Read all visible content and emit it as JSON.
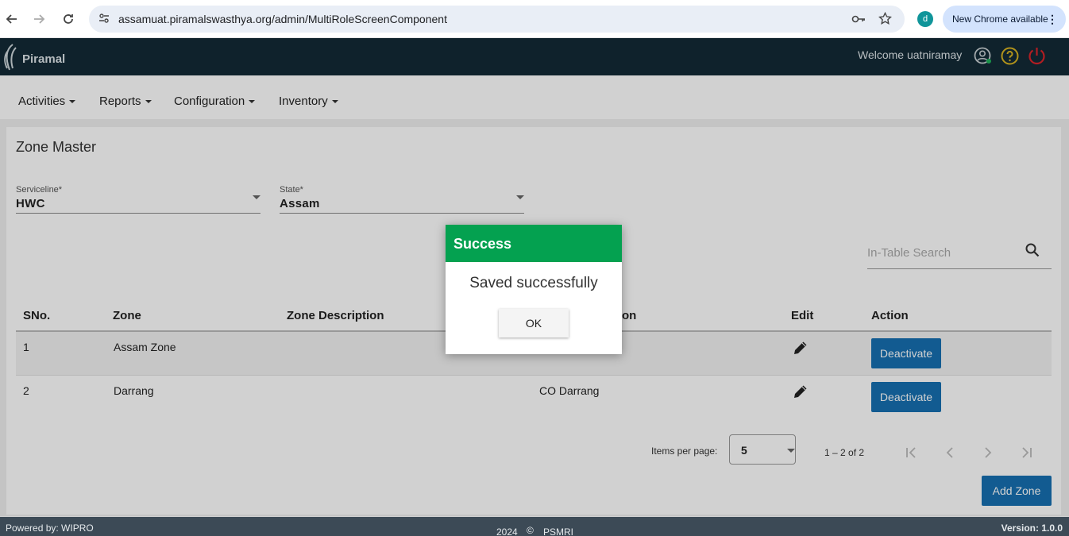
{
  "browser": {
    "url": "assamuat.piramalswasthya.org/admin/MultiRoleScreenComponent",
    "profile_initial": "d",
    "update_chip": "New Chrome available"
  },
  "app": {
    "logo_text": "Piramal",
    "welcome": "Welcome uatniramay",
    "accent_color": "#132a36"
  },
  "menu": {
    "items": [
      {
        "label": "Activities"
      },
      {
        "label": "Reports"
      },
      {
        "label": "Configuration"
      },
      {
        "label": "Inventory"
      }
    ]
  },
  "page": {
    "title": "Zone Master",
    "serviceline": {
      "label": "Serviceline*",
      "value": "HWC"
    },
    "state": {
      "label": "State*",
      "value": "Assam"
    },
    "search_placeholder": "In-Table Search"
  },
  "table": {
    "headers": [
      "SNo.",
      "Zone",
      "Zone Description",
      "on",
      "Edit",
      "Action"
    ],
    "rows": [
      {
        "sno": "1",
        "zone": "Assam Zone",
        "description": "",
        "location": "",
        "action": "Deactivate"
      },
      {
        "sno": "2",
        "zone": "Darrang",
        "description": "",
        "location": "CO Darrang",
        "action": "Deactivate"
      }
    ]
  },
  "paginator": {
    "items_per_page_label": "Items per page:",
    "page_size": "5",
    "range": "1 – 2 of 2"
  },
  "add_button": "Add Zone",
  "footer": {
    "left": "Powered by: WIPRO",
    "center_year": "2024",
    "center_symbol": "©",
    "center_org": "PSMRI",
    "right": "Version: 1.0.0"
  },
  "dialog": {
    "title": "Success",
    "message": "Saved successfully",
    "ok_label": "OK",
    "header_color": "#04a150"
  }
}
